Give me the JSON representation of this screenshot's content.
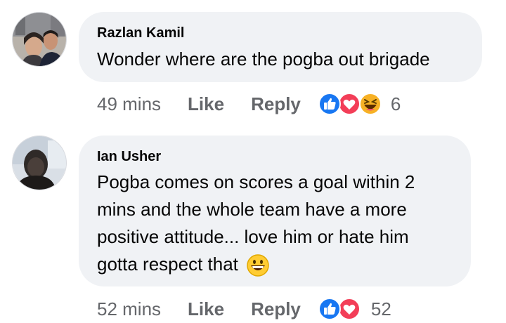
{
  "comments": [
    {
      "author": "Razlan Kamil",
      "text": "Wonder where are the pogba out brigade",
      "time": "49 mins",
      "like_label": "Like",
      "reply_label": "Reply",
      "reaction_icons": [
        "like-icon",
        "love-icon",
        "haha-icon"
      ],
      "reaction_count": "6"
    },
    {
      "author": "Ian Usher",
      "text_lines": [
        "Pogba comes on scores a goal within 2",
        "mins and the whole team have a more",
        "positive attitude... love him or hate him",
        "gotta respect that"
      ],
      "emoji": "grinning-face-emoji"
    },
    {
      "time": "52 mins",
      "like_label": "Like",
      "reply_label": "Reply",
      "reaction_icons": [
        "like-icon",
        "love-icon"
      ],
      "reaction_count": "52"
    }
  ],
  "colors": {
    "bubble_bg": "#f0f2f5",
    "meta_text": "#65676b",
    "like_blue": "#1877f2",
    "love_red": "#f33e58",
    "haha_yellow": "#f7b125"
  }
}
